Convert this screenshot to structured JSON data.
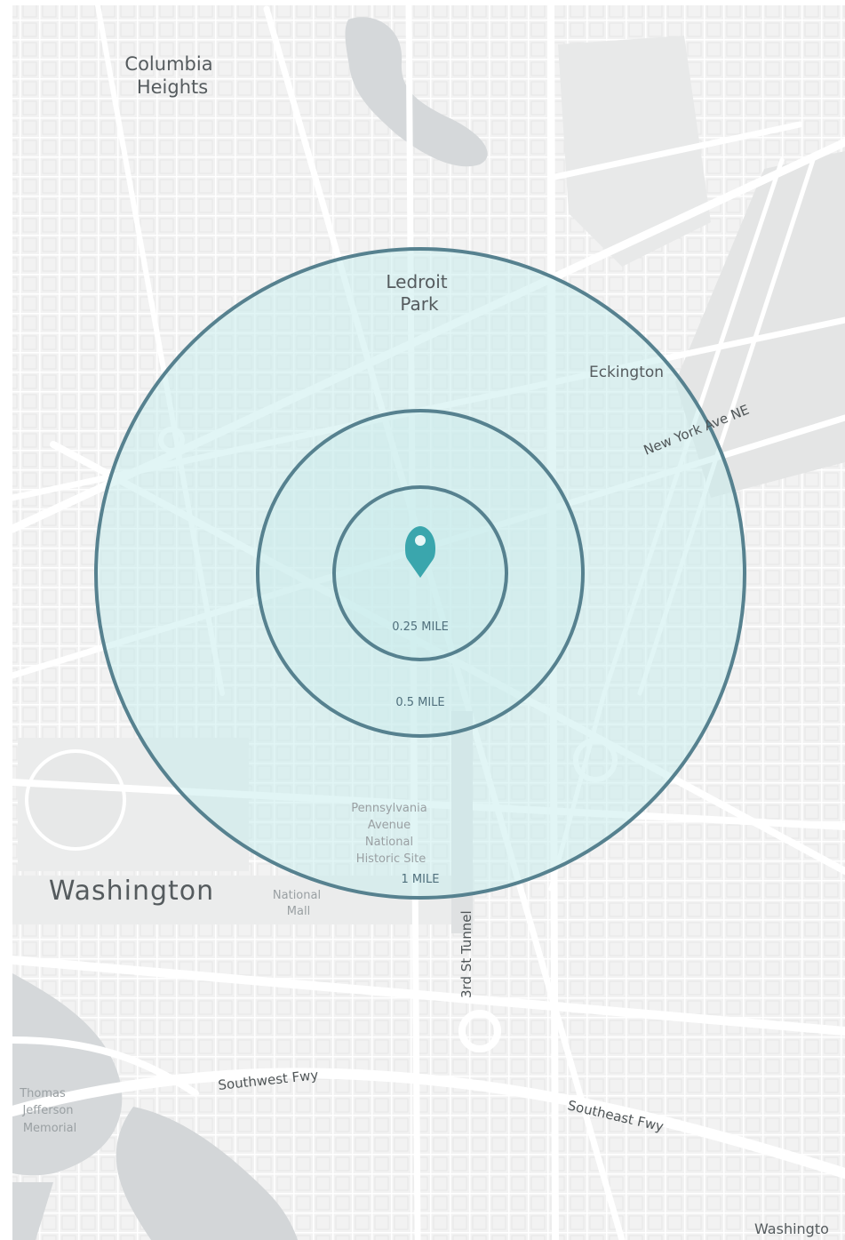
{
  "map": {
    "colors": {
      "land": "#f2f2f2",
      "street": "#ffffff",
      "block": "#e7e8e8",
      "water": "#d5d8da",
      "park": "#e6e8e7",
      "buffer_fill": "#c9ecec",
      "buffer_stroke": "#56818f",
      "marker": "#3aa6ad"
    },
    "place_labels": {
      "columbia_heights": [
        "Columbia",
        "Heights"
      ],
      "ledroit_park": [
        "Ledroit",
        "Park"
      ],
      "eckington": "Eckington",
      "washington": "Washington",
      "national_mall": [
        "National",
        "Mall"
      ],
      "pennsylvania_avenue": [
        "Pennsylvania",
        "Avenue",
        "National",
        "Historic Site"
      ],
      "thomas_jefferson": [
        "Thomas",
        "Jefferson",
        "Memorial"
      ],
      "washington_corner": "Washingto"
    },
    "road_labels": {
      "new_york_ave": "New York Ave NE",
      "third_st_tunnel": "3rd St Tunnel",
      "southwest_fwy": "Southwest Fwy",
      "southeast_fwy": "Southeast Fwy"
    },
    "rings": [
      {
        "label": "0.25 MILE",
        "radius_miles": 0.25
      },
      {
        "label": "0.5 MILE",
        "radius_miles": 0.5
      },
      {
        "label": "1 MILE",
        "radius_miles": 1
      }
    ],
    "marker_icon": "map-pin-icon"
  }
}
